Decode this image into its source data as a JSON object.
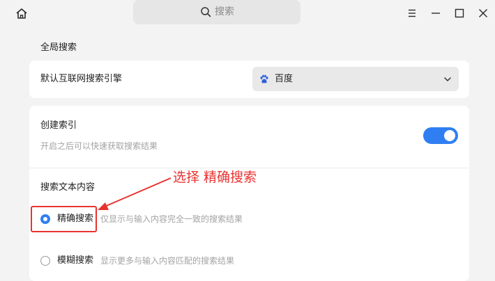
{
  "titlebar": {
    "search_placeholder": "搜索",
    "icons": [
      "home-icon",
      "search-icon",
      "menu-icon",
      "minimize-icon",
      "maximize-icon",
      "close-icon"
    ]
  },
  "global_search": {
    "section_title": "全局搜索",
    "engine_label": "默认互联网搜索引擎",
    "engine_value": "百度",
    "index_title": "创建索引",
    "index_desc": "开启之后可以快速获取搜索结果",
    "index_enabled": true,
    "content_title": "搜索文本内容",
    "options": [
      {
        "label": "精确搜索",
        "desc": "仅显示与输入内容完全一致的搜索结果",
        "selected": true
      },
      {
        "label": "模糊搜索",
        "desc": "显示更多与输入内容匹配的搜索结果",
        "selected": false
      }
    ]
  },
  "annotation": {
    "text": "选择 精确搜索"
  },
  "colors": {
    "accent": "#2f7ff2",
    "annotation": "#e8322f",
    "background": "#f3f3f3",
    "card": "#ffffff"
  }
}
